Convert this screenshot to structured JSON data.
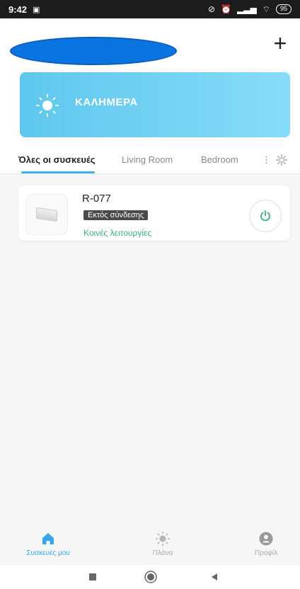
{
  "status_bar": {
    "time": "9:42",
    "battery": "95"
  },
  "header": {
    "add_label": "+"
  },
  "banner": {
    "greeting": "ΚΑΛΗΜΕΡΑ"
  },
  "tabs": [
    {
      "label": "Όλες οι συσκευές",
      "active": true
    },
    {
      "label": "Living Room",
      "active": false
    },
    {
      "label": "Bedroom",
      "active": false
    }
  ],
  "tabs_more": "⋮",
  "device": {
    "name": "R-077",
    "status": "Εκτός σύνδεσης",
    "functions_link": "Κοινές λειτουργίες"
  },
  "bottom_nav": [
    {
      "label": "Συσκευές μου",
      "icon": "home-icon",
      "active": true
    },
    {
      "label": "Πλάνα",
      "icon": "sun-icon",
      "active": false
    },
    {
      "label": "Προφίλ",
      "icon": "profile-icon",
      "active": false
    }
  ],
  "colors": {
    "accent": "#37b6e9",
    "banner_start": "#5fc7ee",
    "banner_end": "#86dcf8",
    "function_link": "#3bb07a",
    "power": "#3bb07a"
  }
}
